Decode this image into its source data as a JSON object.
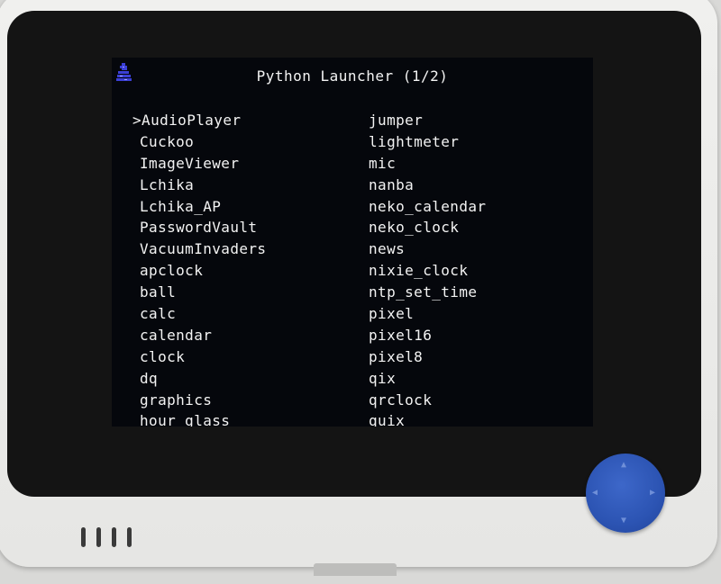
{
  "screen": {
    "title": "Python Launcher (1/2)",
    "selected_index": 0,
    "left_column": [
      ">AudioPlayer",
      "Cuckoo",
      "ImageViewer",
      "Lchika",
      "Lchika_AP",
      "PasswordVault",
      "VacuumInvaders",
      "apclock",
      "ball",
      "calc",
      "calendar",
      "clock",
      "dq",
      "graphics",
      "hour_glass"
    ],
    "right_column": [
      "jumper",
      "lightmeter",
      "mic",
      "nanba",
      "neko_calendar",
      "neko_clock",
      "news",
      "nixie_clock",
      "ntp_set_time",
      "pixel",
      "pixel16",
      "pixel8",
      "qix",
      "qrclock",
      "quix"
    ]
  },
  "colors": {
    "screen_background": "#05070c",
    "text": "#f3f3f3",
    "logo": "#3b3fd6",
    "joystick": "#2c54b3"
  },
  "icons": {
    "logo": "python-logo-icon",
    "joystick": "joystick-icon"
  }
}
